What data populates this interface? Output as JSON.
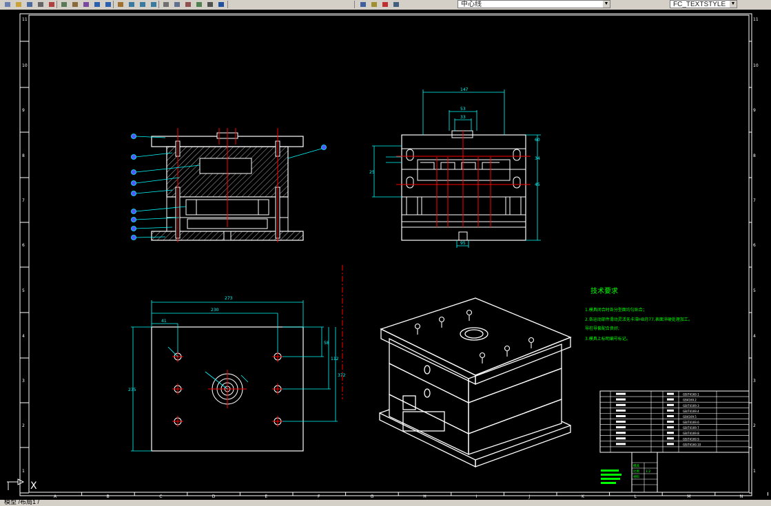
{
  "toolbar": {
    "layer_name": "中心线",
    "text_style": "FC_TEXTSTYLE",
    "icons": [
      "new-icon",
      "open-icon",
      "save-icon",
      "print-icon",
      "cut-icon",
      "copy-icon",
      "paste-icon",
      "match-prop-icon",
      "undo-icon",
      "redo-icon",
      "pan-icon",
      "zoom-realtime-icon",
      "zoom-window-icon",
      "zoom-previous-icon",
      "properties-icon",
      "design-center-icon",
      "tool-palette-icon",
      "markup-icon",
      "calculator-icon",
      "help-icon",
      "layer-manager-icon",
      "layer-state-icon",
      "layer-color-icon",
      "layer-previous-icon",
      "text-style-icon"
    ]
  },
  "drawing": {
    "row_labels": [
      "11",
      "10",
      "9",
      "8",
      "7",
      "6",
      "5",
      "4",
      "3",
      "2",
      "1"
    ],
    "col_labels": [
      "A",
      "B",
      "C",
      "D",
      "E",
      "F",
      "G",
      "H",
      "I",
      "J",
      "K",
      "L",
      "M",
      "N"
    ],
    "dims_side": [
      "147",
      "53",
      "33",
      "25",
      "60",
      "34",
      "45",
      "95"
    ],
    "dims_top": [
      "273",
      "230",
      "41",
      "58",
      "112",
      "372",
      "235"
    ],
    "tech_req": {
      "title": "技术要求",
      "lines": [
        "1.模具闭合时各分型面均匀贴合；",
        "2.各运动部件滑动灵活无卡滞HB月77,表面淬硬处理加工。",
        "   导柱导套配合良好;",
        "3.模具上标明编号标记。"
      ]
    },
    "bom_rows": [
      "GB/T4169.1",
      "GB4169.2",
      "GB/T4169.3",
      "GB/T4169.4",
      "GB4169.5",
      "GB/T4169.6",
      "GB/T4169.7",
      "GB/T4169.8",
      "GB/T4169.9",
      "GB/T4169.10"
    ],
    "title_block": [
      "模具",
      "比例",
      "1:2",
      "材料"
    ],
    "ucs_label": "X"
  },
  "status": {
    "tabs_text": "模型 /布局1 /"
  },
  "colors": {
    "background": "#000000",
    "line": "#ffffff",
    "centerline": "#ff0000",
    "dimension": "#00ffff",
    "text_green": "#00ff00",
    "balloon": "#5555ff"
  }
}
